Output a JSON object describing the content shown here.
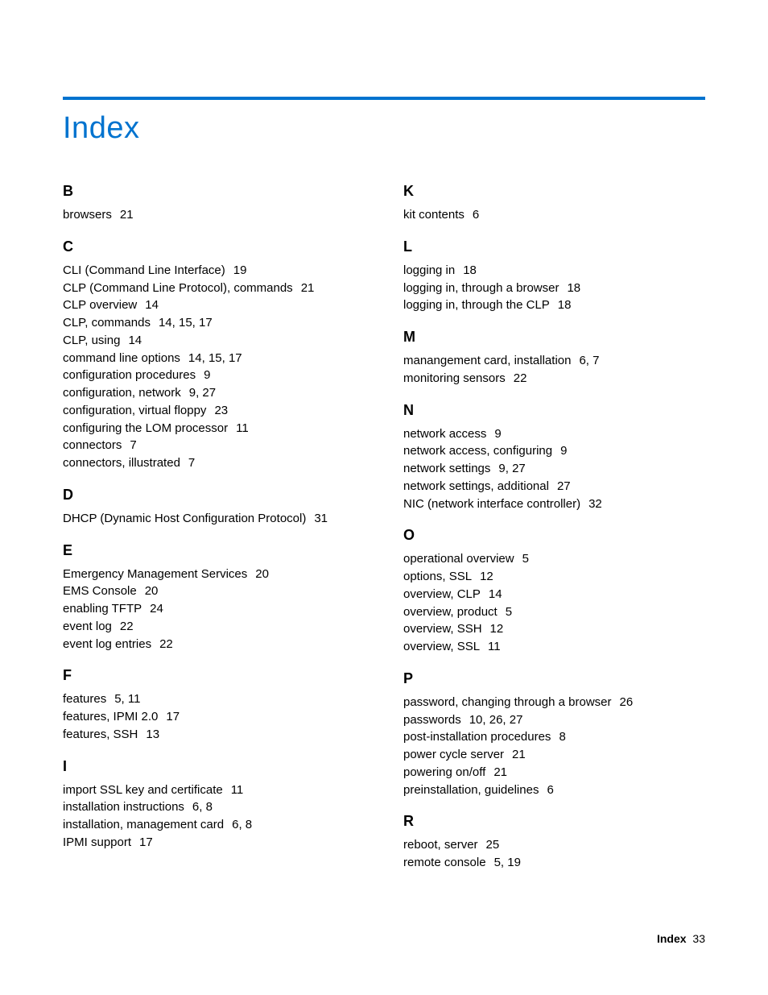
{
  "title": "Index",
  "footer": {
    "label": "Index",
    "page": "33"
  },
  "columns": [
    [
      {
        "letter": "B",
        "entries": [
          {
            "term": "browsers",
            "pages": "21"
          }
        ]
      },
      {
        "letter": "C",
        "entries": [
          {
            "term": "CLI (Command Line Interface)",
            "pages": "19"
          },
          {
            "term": "CLP (Command Line Protocol), commands",
            "pages": "21"
          },
          {
            "term": "CLP overview",
            "pages": "14"
          },
          {
            "term": "CLP, commands",
            "pages": "14, 15, 17"
          },
          {
            "term": "CLP, using",
            "pages": "14"
          },
          {
            "term": "command line options",
            "pages": "14, 15, 17"
          },
          {
            "term": "configuration procedures",
            "pages": "9"
          },
          {
            "term": "configuration, network",
            "pages": "9, 27"
          },
          {
            "term": "configuration, virtual floppy",
            "pages": "23"
          },
          {
            "term": "configuring the LOM processor",
            "pages": "11"
          },
          {
            "term": "connectors",
            "pages": "7"
          },
          {
            "term": "connectors, illustrated",
            "pages": "7"
          }
        ]
      },
      {
        "letter": "D",
        "entries": [
          {
            "term": "DHCP (Dynamic Host Configuration Protocol)",
            "pages": "31"
          }
        ]
      },
      {
        "letter": "E",
        "entries": [
          {
            "term": "Emergency Management Services",
            "pages": "20"
          },
          {
            "term": "EMS Console",
            "pages": "20"
          },
          {
            "term": "enabling TFTP",
            "pages": "24"
          },
          {
            "term": "event log",
            "pages": "22"
          },
          {
            "term": "event log entries",
            "pages": "22"
          }
        ]
      },
      {
        "letter": "F",
        "entries": [
          {
            "term": "features",
            "pages": "5, 11"
          },
          {
            "term": "features, IPMI 2.0",
            "pages": "17"
          },
          {
            "term": "features, SSH",
            "pages": "13"
          }
        ]
      },
      {
        "letter": "I",
        "entries": [
          {
            "term": "import SSL key and certificate",
            "pages": "11"
          },
          {
            "term": "installation instructions",
            "pages": "6, 8"
          },
          {
            "term": "installation, management card",
            "pages": "6, 8"
          },
          {
            "term": "IPMI support",
            "pages": "17"
          }
        ]
      }
    ],
    [
      {
        "letter": "K",
        "entries": [
          {
            "term": "kit contents",
            "pages": "6"
          }
        ]
      },
      {
        "letter": "L",
        "entries": [
          {
            "term": "logging in",
            "pages": "18"
          },
          {
            "term": "logging in, through a browser",
            "pages": "18"
          },
          {
            "term": "logging in, through the CLP",
            "pages": "18"
          }
        ]
      },
      {
        "letter": "M",
        "entries": [
          {
            "term": "manangement card, installation",
            "pages": "6, 7"
          },
          {
            "term": "monitoring sensors",
            "pages": "22"
          }
        ]
      },
      {
        "letter": "N",
        "entries": [
          {
            "term": "network access",
            "pages": "9"
          },
          {
            "term": "network access, configuring",
            "pages": "9"
          },
          {
            "term": "network settings",
            "pages": "9, 27"
          },
          {
            "term": "network settings, additional",
            "pages": "27"
          },
          {
            "term": "NIC (network interface controller)",
            "pages": "32"
          }
        ]
      },
      {
        "letter": "O",
        "entries": [
          {
            "term": "operational overview",
            "pages": "5"
          },
          {
            "term": "options, SSL",
            "pages": "12"
          },
          {
            "term": "overview, CLP",
            "pages": "14"
          },
          {
            "term": "overview, product",
            "pages": "5"
          },
          {
            "term": "overview, SSH",
            "pages": "12"
          },
          {
            "term": "overview, SSL",
            "pages": "11"
          }
        ]
      },
      {
        "letter": "P",
        "entries": [
          {
            "term": "password, changing through a browser",
            "pages": "26"
          },
          {
            "term": "passwords",
            "pages": "10, 26, 27"
          },
          {
            "term": "post-installation procedures",
            "pages": "8"
          },
          {
            "term": "power cycle server",
            "pages": "21"
          },
          {
            "term": "powering on/off",
            "pages": "21"
          },
          {
            "term": "preinstallation, guidelines",
            "pages": "6"
          }
        ]
      },
      {
        "letter": "R",
        "entries": [
          {
            "term": "reboot, server",
            "pages": "25"
          },
          {
            "term": "remote console",
            "pages": "5, 19"
          }
        ]
      }
    ]
  ]
}
